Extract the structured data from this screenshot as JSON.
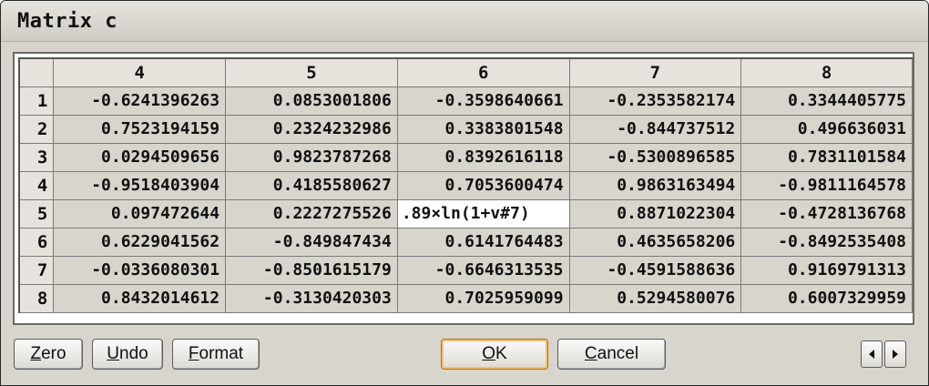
{
  "window": {
    "title": "Matrix c"
  },
  "grid": {
    "columns": [
      "4",
      "5",
      "6",
      "7",
      "8"
    ],
    "rows": [
      {
        "label": "1",
        "cells": [
          "-0.6241396263",
          "0.0853001806",
          "-0.3598640661",
          "-0.2353582174",
          "0.3344405775"
        ]
      },
      {
        "label": "2",
        "cells": [
          "0.7523194159",
          "0.2324232986",
          "0.3383801548",
          "-0.844737512",
          "0.496636031"
        ]
      },
      {
        "label": "3",
        "cells": [
          "0.0294509656",
          "0.9823787268",
          "0.8392616118",
          "-0.5300896585",
          "0.7831101584"
        ]
      },
      {
        "label": "4",
        "cells": [
          "-0.9518403904",
          "0.4185580627",
          "0.7053600474",
          "0.9863163494",
          "-0.9811164578"
        ]
      },
      {
        "label": "5",
        "cells": [
          "0.097472644",
          "0.2227275526",
          ".89×ln(1+v#7)",
          "0.8871022304",
          "-0.4728136768"
        ]
      },
      {
        "label": "6",
        "cells": [
          "0.6229041562",
          "-0.849847434",
          "0.6141764483",
          "0.4635658206",
          "-0.8492535408"
        ]
      },
      {
        "label": "7",
        "cells": [
          "-0.0336080301",
          "-0.8501615179",
          "-0.6646313535",
          "-0.4591588636",
          "0.9169791313"
        ]
      },
      {
        "label": "8",
        "cells": [
          "0.8432014612",
          "-0.3130420303",
          "0.7025959099",
          "0.5294580076",
          "0.6007329959"
        ]
      }
    ],
    "active_cell": {
      "row": "5",
      "column": "6"
    }
  },
  "buttons": {
    "zero": {
      "first": "Z",
      "rest": "ero"
    },
    "undo": {
      "first": "U",
      "rest": "ndo"
    },
    "format": {
      "first": "F",
      "rest": "ormat"
    },
    "ok": {
      "first": "O",
      "rest": "K"
    },
    "cancel": {
      "first": "C",
      "rest": "ancel"
    }
  },
  "icons": {
    "scroll_left": "left-arrow-icon",
    "scroll_right": "right-arrow-icon"
  }
}
